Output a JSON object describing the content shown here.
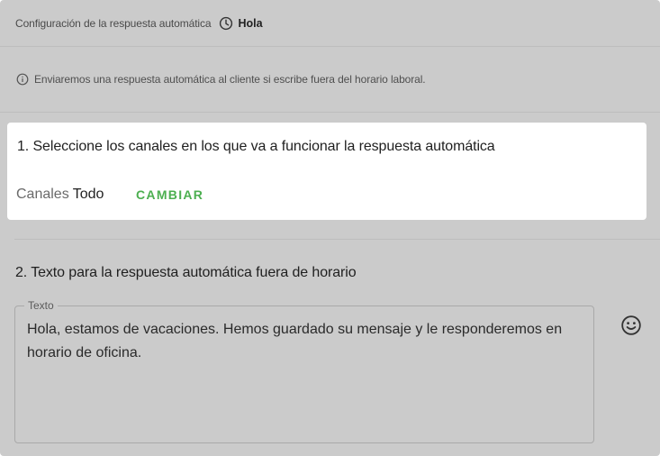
{
  "header": {
    "breadcrumb": "Configuración de la respuesta automática",
    "clock_icon": "clock-icon",
    "schedule_name": "Hola"
  },
  "info": {
    "icon": "info-icon",
    "text": "Enviaremos una respuesta automática al cliente si escribe fuera del horario laboral."
  },
  "channels_section": {
    "title": "1. Seleccione los canales en los que va a funcionar la respuesta automática",
    "label": "Canales",
    "value": "Todo",
    "change_label": "CAMBIAR"
  },
  "text_section": {
    "title": "2. Texto para la respuesta automática fuera de horario",
    "field_label": "Texto",
    "field_value": "Hola, estamos de vacaciones. Hemos guardado su mensaje y le responderemos en horario de oficina.",
    "emoji_icon": "emoji-icon"
  },
  "colors": {
    "overlay_bg": "#cbcbcb",
    "card_bg": "#ffffff",
    "accent_green": "#4caf50"
  }
}
